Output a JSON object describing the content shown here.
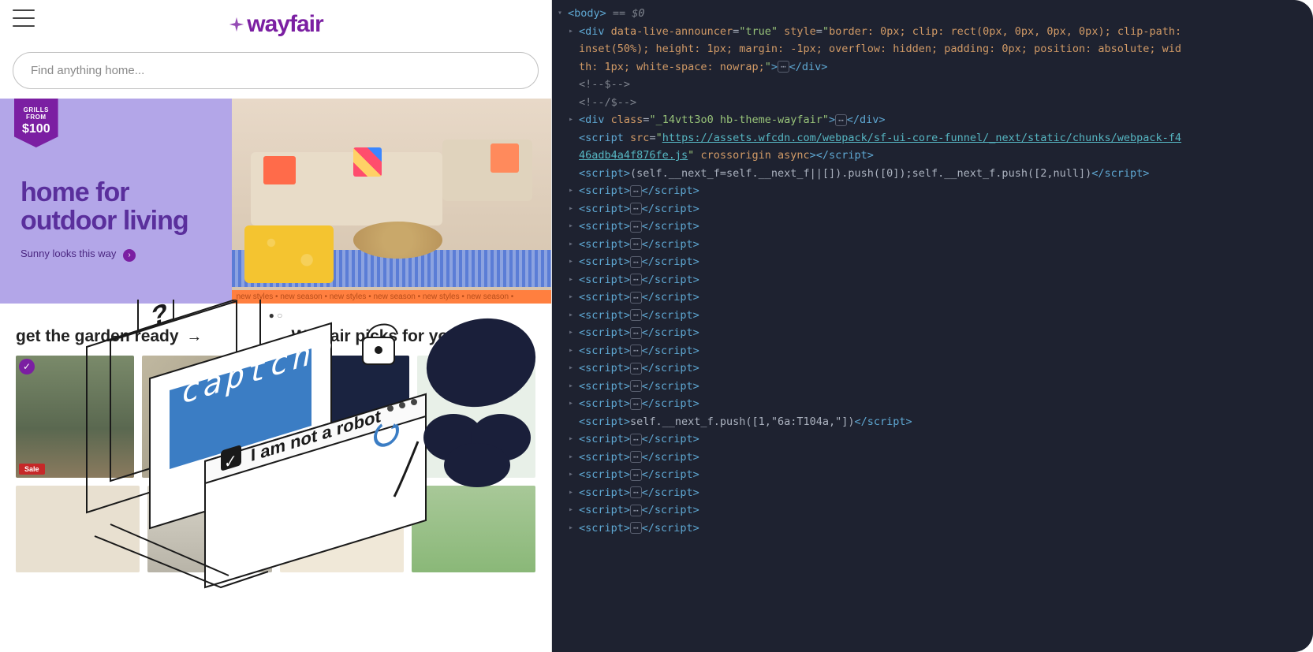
{
  "site": {
    "brand": "wayfair",
    "search_placeholder": "Find anything home...",
    "grills_badge": {
      "line1": "GRILLS",
      "line2": "FROM",
      "price": "$100"
    },
    "hero": {
      "title_line1": "home for",
      "title_line2": "outdoor living",
      "subtitle": "Sunny looks this way"
    },
    "ticker": "new styles • new season • new styles • new season • new styles • new season •",
    "sections": {
      "garden_title": "get the garden ready",
      "picks_title": "Wayfair picks for you"
    },
    "sale_label": "Sale"
  },
  "captcha_illustration": {
    "captcha_word": "captcha",
    "robot_text": "I am not a robot",
    "question_mark": "?"
  },
  "devtools": {
    "body_open": "<body>",
    "body_eq": " == $0",
    "div1_open": "<div",
    "div1_attr1_name": "data-live-announcer",
    "div1_attr1_val": "\"true\"",
    "div1_attr2_name": "style",
    "div1_attr2_val": "\"border: 0px; clip: rect(0px, 0px, 0px, 0px); clip-path: inset(50%); height: 1px; margin: -1px; overflow: hidden; padding: 0px; position: absolute; width: 1px; white-space: nowrap;\"",
    "div_close": "</div>",
    "comment1": "<!--$-->",
    "comment2": "<!--/$-->",
    "div2_open": "<div",
    "div2_attr_name": "class",
    "div2_attr_val": "\"_14vtt3o0 hb-theme-wayfair\"",
    "script_ext_open": "<script",
    "script_ext_src_name": "src",
    "script_ext_src_val": "https://assets.wfcdn.com/webpack/sf-ui-core-funnel/_next/static/chunks/webpack-f446adb4a4f876fe.js",
    "script_ext_attrs": " crossorigin async",
    "script_close_tag": "</script>",
    "script_inline1": "(self.__next_f=self.__next_f||[]).push([0]);self.__next_f.push([2,null])",
    "script_inline2": "self.__next_f.push([1,\"6a:T104a,\"])",
    "script_label": "<script>",
    "num_collapsed_scripts_block1": 13,
    "num_collapsed_scripts_block2": 6
  }
}
